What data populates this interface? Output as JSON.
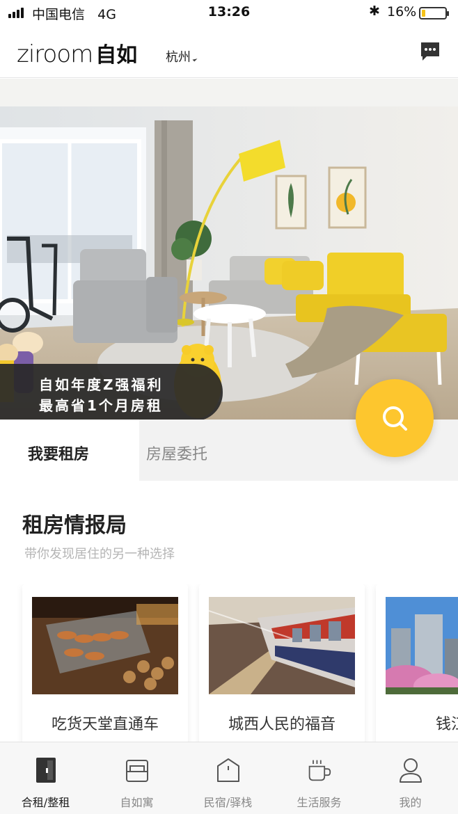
{
  "status_bar": {
    "carrier": "中国电信",
    "network": "4G",
    "time": "13:26",
    "battery_percent": "16%",
    "battery_level": 0.16
  },
  "header": {
    "logo_text": "ziroom",
    "logo_cn": "自如",
    "city": "杭州"
  },
  "banner": {
    "promo_line1": "自如年度Z强福利",
    "promo_line2": "最高省1个月房租"
  },
  "tabs": [
    {
      "label": "我要租房",
      "active": true
    },
    {
      "label": "房屋委托",
      "active": false
    }
  ],
  "section": {
    "title": "租房情报局",
    "subtitle": "带你发现居住的另一种选择"
  },
  "cards": [
    {
      "title": "吃货天堂直通车"
    },
    {
      "title": "城西人民的福音"
    },
    {
      "title": "钱江世"
    }
  ],
  "bottom_nav": [
    {
      "label": "合租/整租",
      "icon": "door-icon",
      "active": true
    },
    {
      "label": "自如寓",
      "icon": "bed-icon",
      "active": false
    },
    {
      "label": "民宿/驿栈",
      "icon": "house-icon",
      "active": false
    },
    {
      "label": "生活服务",
      "icon": "cup-icon",
      "active": false
    },
    {
      "label": "我的",
      "icon": "user-icon",
      "active": false
    }
  ],
  "colors": {
    "accent_yellow": "#fdc62e",
    "promo_bg": "#282828"
  }
}
